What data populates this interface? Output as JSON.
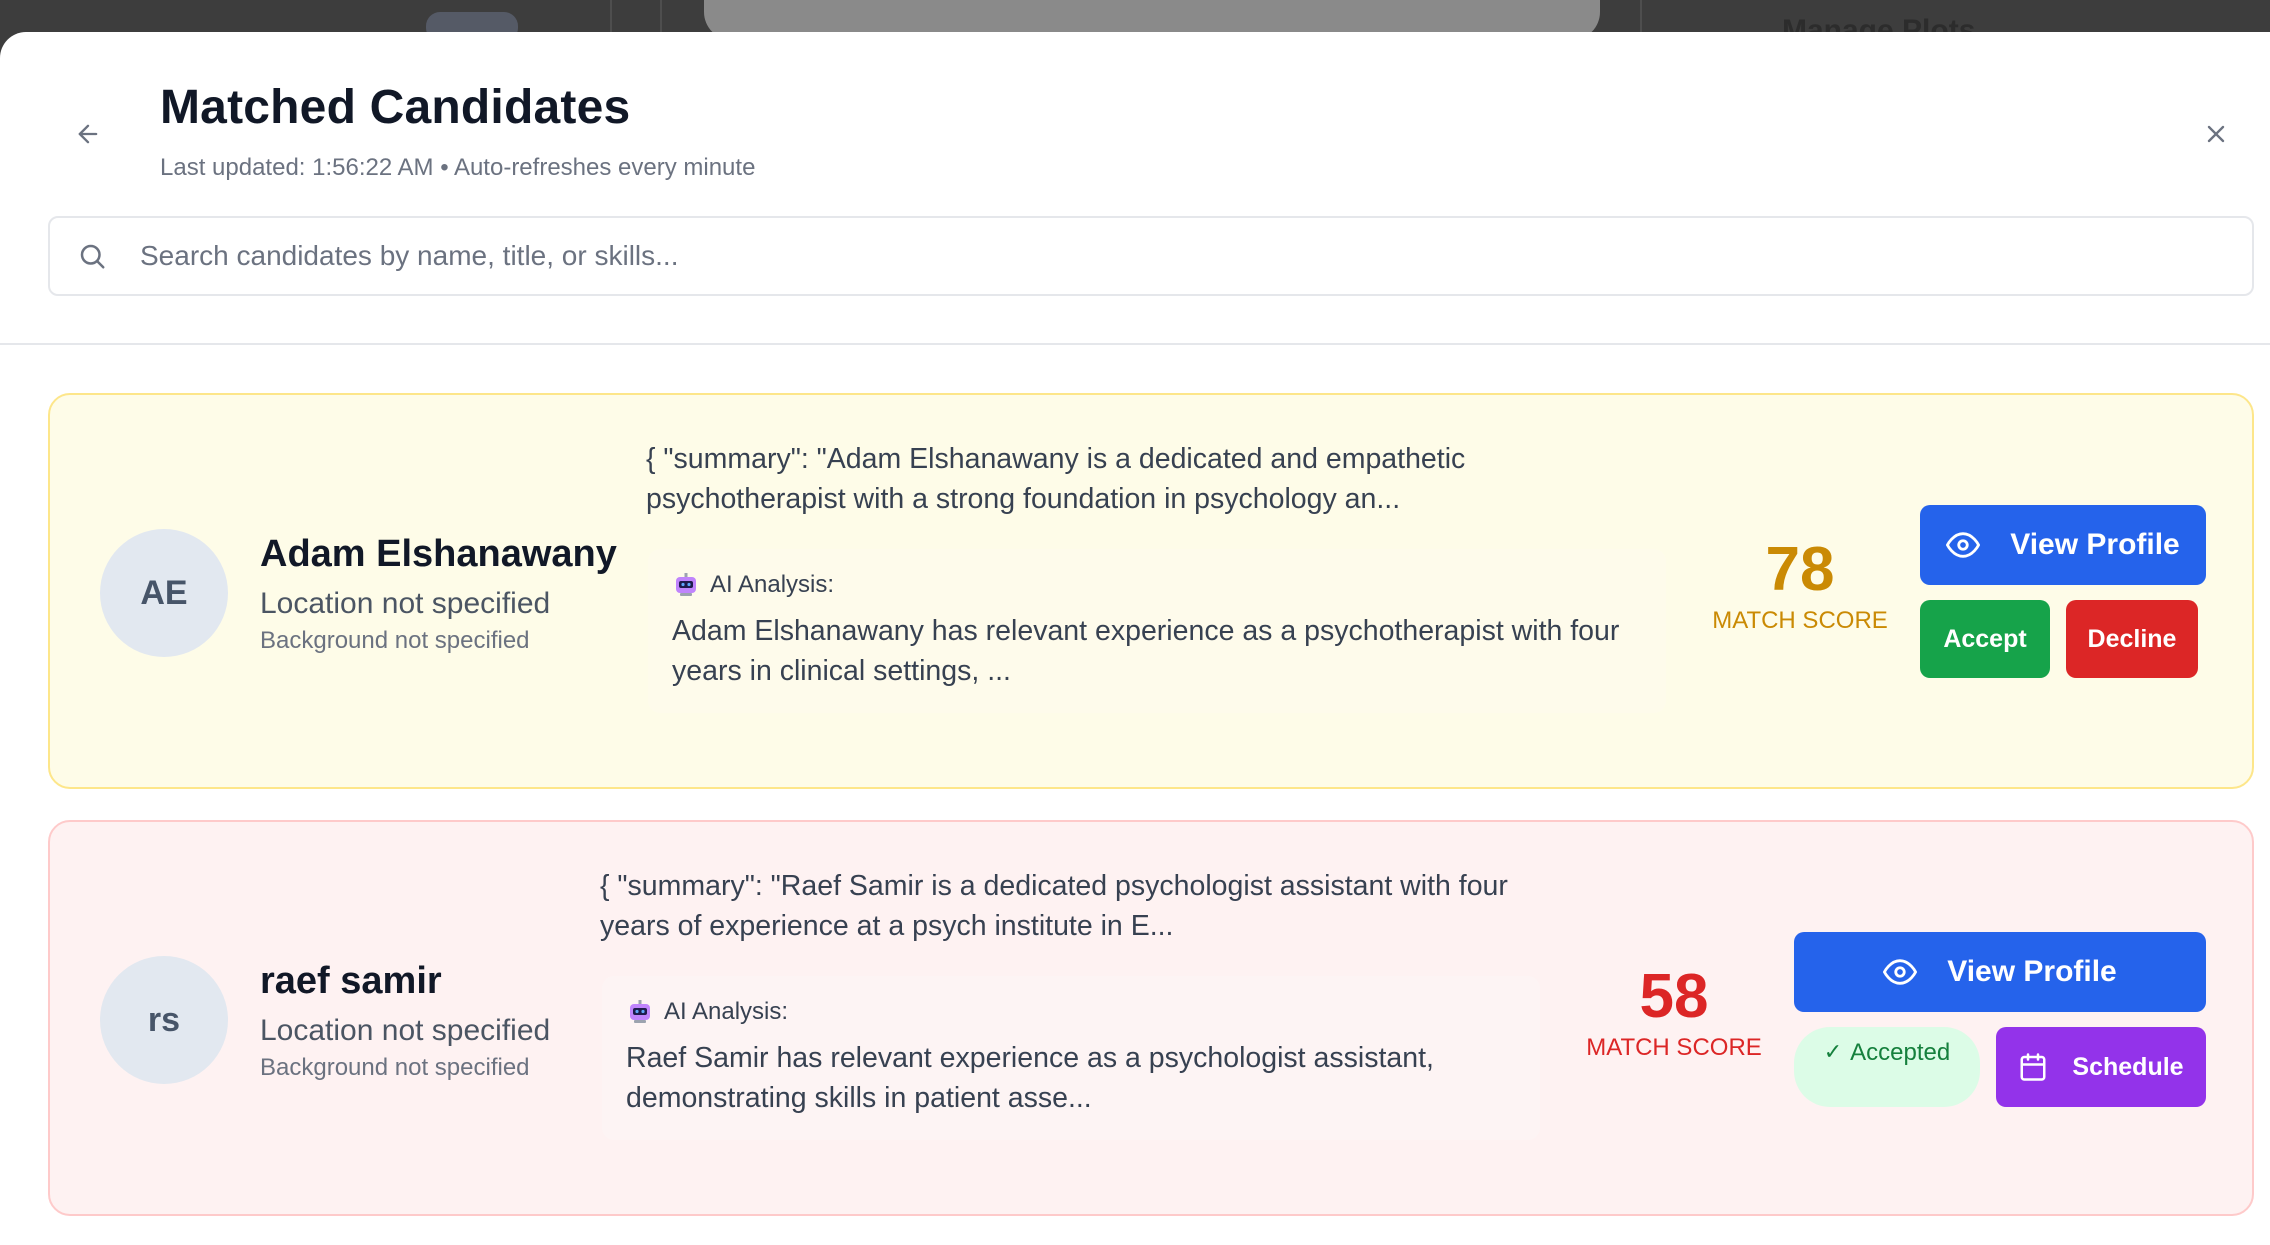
{
  "background": {
    "partial_heading": "Manage Plots"
  },
  "header": {
    "title": "Matched Candidates",
    "subtitle": "Last updated: 1:56:22 AM • Auto-refreshes every minute",
    "back_icon": "arrow-left-icon",
    "close_icon": "close-icon"
  },
  "search": {
    "placeholder": "Search candidates by name, title, or skills...",
    "value": "",
    "icon": "search-icon"
  },
  "candidates": [
    {
      "initials": "AE",
      "name": "Adam Elshanawany",
      "location": "Location not specified",
      "background": "Background not specified",
      "summary": "{ \"summary\": \"Adam Elshanawany is a dedicated and empathetic psychotherapist with a strong foundation in psychology an...",
      "ai_label": "AI Analysis:",
      "ai_text": "Adam Elshanawany has relevant experience as a psychotherapist with four years in clinical settings, ...",
      "score": "78",
      "score_label": "MATCH SCORE",
      "view_label": "View Profile",
      "accept_label": "Accept",
      "decline_label": "Decline",
      "status": "pending",
      "card_color": "#fefce8",
      "score_color": "#ca8a04"
    },
    {
      "initials": "rs",
      "name": "raef samir",
      "location": "Location not specified",
      "background": "Background not specified",
      "summary": "{ \"summary\": \"Raef Samir is a dedicated psychologist assistant with four years of experience at a psych institute in E...",
      "ai_label": "AI Analysis:",
      "ai_text": "Raef Samir has relevant experience as a psychologist assistant, demonstrating skills in patient asse...",
      "score": "58",
      "score_label": "MATCH SCORE",
      "view_label": "View Profile",
      "accepted_label": "Accepted",
      "schedule_label": "Schedule",
      "status": "accepted",
      "card_color": "#fef2f2",
      "score_color": "#dc2626"
    }
  ],
  "colors": {
    "primary": "#2563eb",
    "accept": "#16a34a",
    "decline": "#dc2626",
    "schedule": "#9333ea"
  }
}
